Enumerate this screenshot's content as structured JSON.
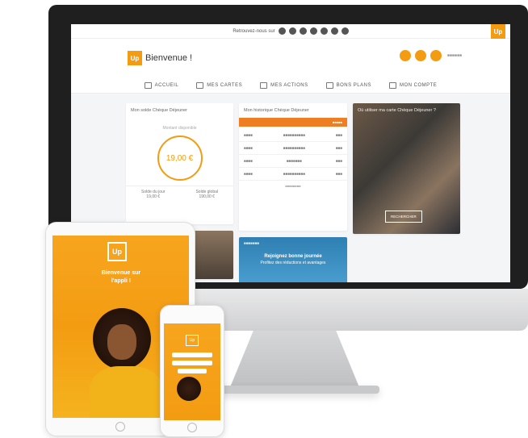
{
  "social_bar": {
    "label": "Retrouvez-nous sur"
  },
  "header": {
    "brand": "Up",
    "welcome": "Bienvenue !",
    "user": "■■■■■■"
  },
  "nav": [
    {
      "label": "ACCUEIL",
      "icon": "grid-icon"
    },
    {
      "label": "MES CARTES",
      "icon": "card-icon"
    },
    {
      "label": "MES ACTIONS",
      "icon": "history-icon"
    },
    {
      "label": "BONS PLANS",
      "icon": "deals-icon"
    },
    {
      "label": "MON COMPTE",
      "icon": "user-icon"
    }
  ],
  "solde_card": {
    "title": "Mon solde Chèque Déjeuner",
    "available_label": "Montant disponible",
    "amount": "19,00 €",
    "left_label": "Solde du jour",
    "left_value": "19,00 €",
    "right_label": "Solde global",
    "right_value": "190,00 €"
  },
  "history_card": {
    "title": "Mon historique Chèque Déjeuner",
    "bar_left": "",
    "bar_right": "■■■■■",
    "rows": [
      {
        "date": "■■■■",
        "label": "■■■■■■■■■■",
        "amount": "■■■"
      },
      {
        "date": "■■■■",
        "label": "■■■■■■■■■■",
        "amount": "■■■"
      },
      {
        "date": "■■■■",
        "label": "■■■■■■■",
        "amount": "■■■"
      },
      {
        "date": "■■■■",
        "label": "■■■■■■■■■■",
        "amount": "■■■"
      }
    ],
    "more": "■■■■■■■■"
  },
  "photo_card": {
    "title": "Où utiliser ma carte Chèque Déjeuner ?",
    "button": "RECHERCHER"
  },
  "promo_card": {
    "tag": "■■■■■■■",
    "headline": "Rejoignez bonne journée",
    "sub": "Profitez des réductions et avantages"
  },
  "tablet": {
    "logo": "Up",
    "text": "Bienvenue sur l'appli !"
  },
  "phone": {
    "logo": "Up"
  }
}
